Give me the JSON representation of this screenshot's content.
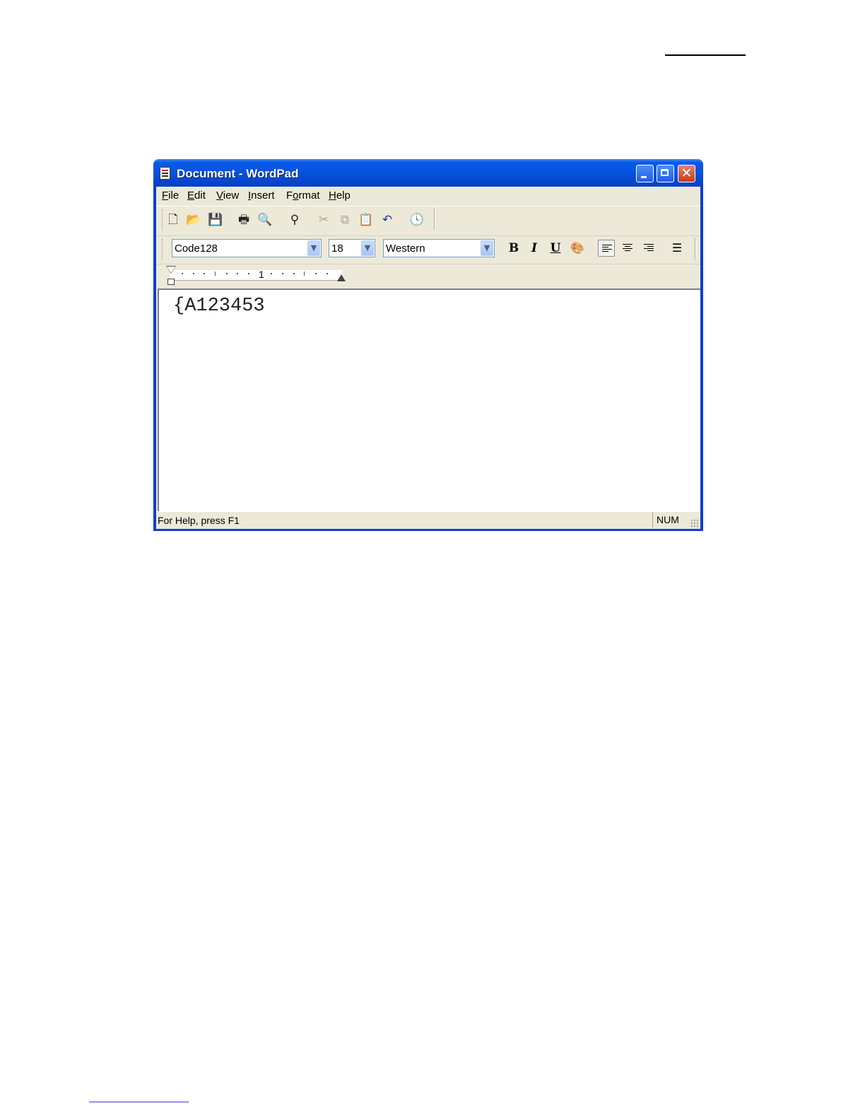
{
  "window": {
    "title": "Document - WordPad"
  },
  "menu": {
    "file": {
      "accel": "F",
      "rest": "ile"
    },
    "edit": {
      "accel": "E",
      "rest": "dit"
    },
    "view": {
      "accel": "V",
      "rest": "iew"
    },
    "insert": {
      "accel": "I",
      "rest": "nsert"
    },
    "format": {
      "pre": "F",
      "accel": "o",
      "rest": "rmat"
    },
    "help": {
      "accel": "H",
      "rest": "elp"
    }
  },
  "toolbar": {
    "icons": [
      "new-icon",
      "open-icon",
      "save-icon",
      "print-icon",
      "print-preview-icon",
      "find-icon",
      "cut-icon",
      "copy-icon",
      "paste-icon",
      "undo-icon",
      "date-time-icon"
    ]
  },
  "formatbar": {
    "font": "Code128",
    "size": "18",
    "script": "Western",
    "bold": "B",
    "italic": "I",
    "underline": "U"
  },
  "ruler": {
    "label": "1"
  },
  "document": {
    "text": "{A123453"
  },
  "status": {
    "help": "For Help, press F1",
    "num": "NUM"
  },
  "colors": {
    "titlebar": "#0754df",
    "chrome": "#ece9d8",
    "close": "#c23c1d"
  }
}
